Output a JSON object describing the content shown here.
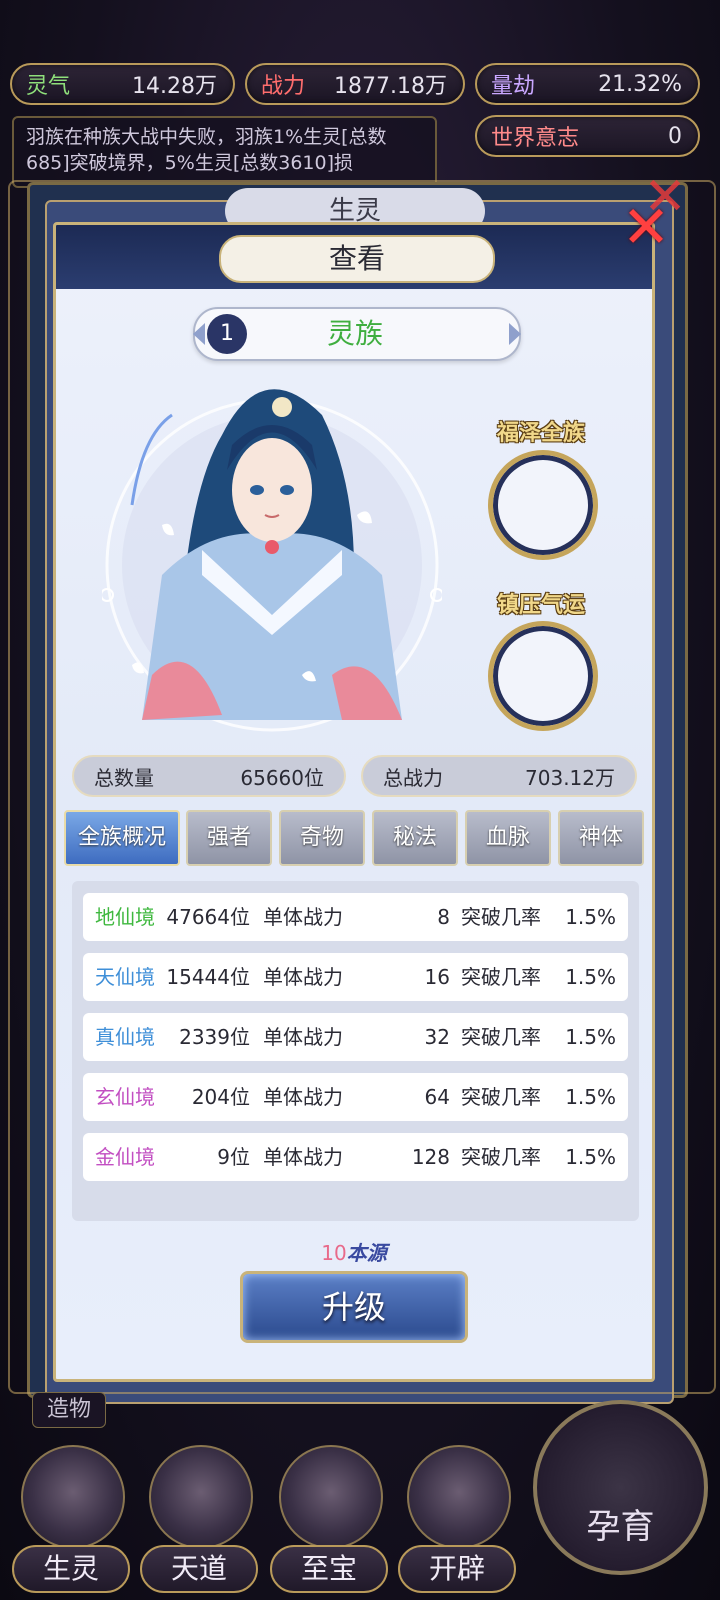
{
  "resources": {
    "lingqi": {
      "label": "灵气",
      "value": "14.28万"
    },
    "zhanli": {
      "label": "战力",
      "value": "1877.18万"
    },
    "liangjie": {
      "label": "量劫",
      "value": "21.32%"
    },
    "world_will": {
      "label": "世界意志",
      "value": "0"
    }
  },
  "log_text": "羽族在种族大战中失败，羽族1%生灵[总数685]突破境界，5%生灵[总数3610]损",
  "back_tab": "生灵",
  "dialog": {
    "title": "查看",
    "race_index": "1",
    "race_name": "灵族",
    "slot1_label": "福泽全族",
    "slot2_label": "镇压气运",
    "total_count_label": "总数量",
    "total_count_value": "65660位",
    "total_power_label": "总战力",
    "total_power_value": "703.12万",
    "tabs": [
      "全族概况",
      "强者",
      "奇物",
      "秘法",
      "血脉",
      "神体"
    ],
    "rows": [
      {
        "realm": "地仙境",
        "color": "#3fb83f",
        "count": "47664位",
        "power_label": "单体战力",
        "power": "8",
        "rate_label": "突破几率",
        "rate": "1.5%"
      },
      {
        "realm": "天仙境",
        "color": "#3f8fd8",
        "count": "15444位",
        "power_label": "单体战力",
        "power": "16",
        "rate_label": "突破几率",
        "rate": "1.5%"
      },
      {
        "realm": "真仙境",
        "color": "#3f8fd8",
        "count": "2339位",
        "power_label": "单体战力",
        "power": "32",
        "rate_label": "突破几率",
        "rate": "1.5%"
      },
      {
        "realm": "玄仙境",
        "color": "#c24fc2",
        "count": "204位",
        "power_label": "单体战力",
        "power": "64",
        "rate_label": "突破几率",
        "rate": "1.5%"
      },
      {
        "realm": "金仙境",
        "color": "#c24fc2",
        "count": "9位",
        "power_label": "单体战力",
        "power": "128",
        "rate_label": "突破几率",
        "rate": "1.5%"
      }
    ],
    "cost_num": "10",
    "cost_unit": "本源",
    "upgrade_label": "升级"
  },
  "bottom": {
    "zaowu": "造物",
    "nav": [
      "生灵",
      "天道",
      "至宝",
      "开辟"
    ],
    "nurture": "孕育"
  }
}
